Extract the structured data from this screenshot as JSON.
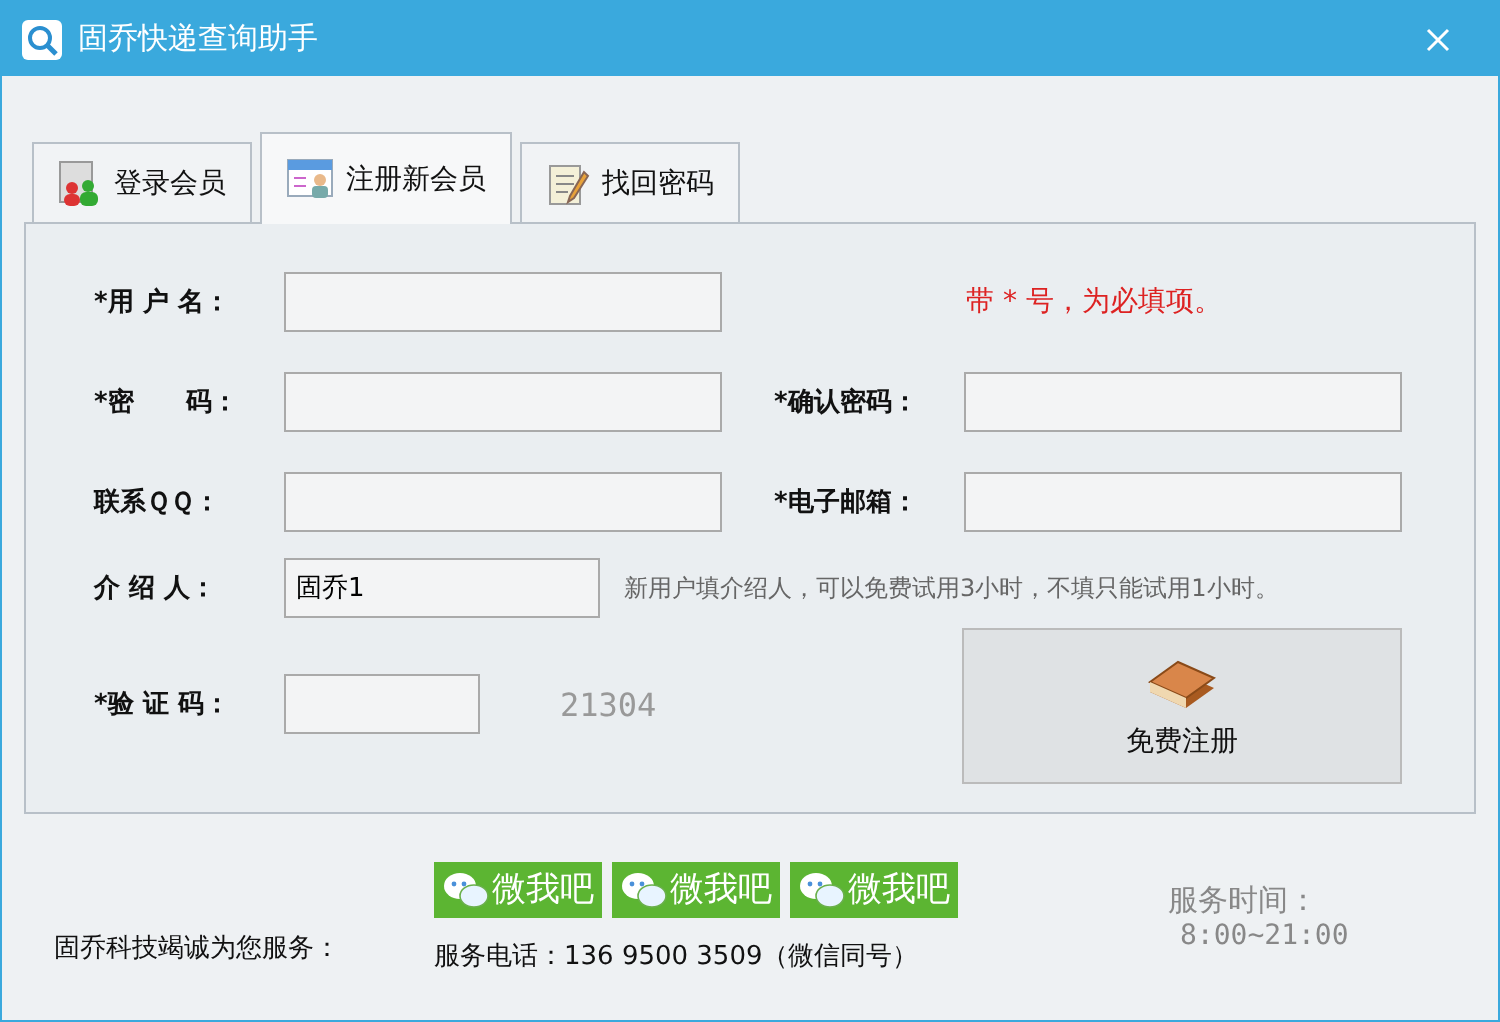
{
  "window": {
    "title": "固乔快递查询助手"
  },
  "tabs": [
    {
      "label": "登录会员",
      "selected": false
    },
    {
      "label": "注册新会员",
      "selected": true
    },
    {
      "label": "找回密码",
      "selected": false
    }
  ],
  "form": {
    "note": "带 * 号，为必填项。",
    "username": {
      "label": "*用 户 名："
    },
    "password": {
      "label": "*密　　码："
    },
    "confirm": {
      "label": "*确认密码："
    },
    "qq": {
      "label": "联系ＱＱ："
    },
    "email": {
      "label": "*电子邮箱："
    },
    "referrer": {
      "label": "介 绍 人：",
      "value": "固乔1",
      "hint": "新用户填介绍人，可以免费试用3小时，不填只能试用1小时。"
    },
    "captcha": {
      "label": "*验 证 码：",
      "code": "21304"
    },
    "submit": "免费注册"
  },
  "footer": {
    "slogan": "固乔科技竭诚为您服务：",
    "wechat_buttons": [
      "微我吧",
      "微我吧",
      "微我吧"
    ],
    "phone": "服务电话：136 9500 3509（微信同号）",
    "hours_label": "服务时间：",
    "hours": "8:00~21:00"
  }
}
